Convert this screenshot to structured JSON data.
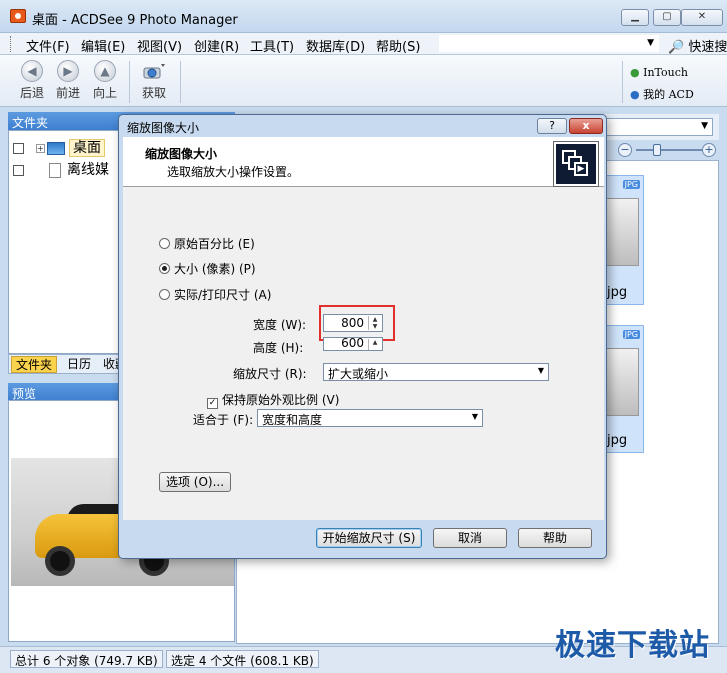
{
  "window": {
    "title": "桌面 - ACDSee 9 Photo Manager",
    "min_icon": "minimize-icon",
    "max_icon": "maximize-icon",
    "close_icon": "close-icon"
  },
  "menu": {
    "items": [
      "文件(F)",
      "编辑(E)",
      "视图(V)",
      "创建(R)",
      "工具(T)",
      "数据库(D)",
      "帮助(S)"
    ],
    "quick_search": "快速搜"
  },
  "toolbar": {
    "back": "后退",
    "forward": "前进",
    "up": "向上",
    "acquire": "获取",
    "intouch": "InTouch",
    "my_acd": "我的 ACD"
  },
  "folders_pane": {
    "header": "文件夹",
    "tree": [
      {
        "label": "桌面",
        "selected": true
      },
      {
        "label": "离线媒"
      }
    ],
    "tabs": [
      "文件夹",
      "日历",
      "收藏"
    ]
  },
  "preview_pane": {
    "header": "预览"
  },
  "thumbnails": [
    {
      "badge": "JPG",
      "label": "jpg"
    },
    {
      "badge": "JPG",
      "label": "jpg"
    }
  ],
  "status": {
    "total": "总计 6 个对象 (749.7 KB)",
    "selected": "选定 4 个文件 (608.1 KB)"
  },
  "watermark": "极速下载站",
  "dialog": {
    "title": "缩放图像大小",
    "help_btn": "?",
    "close_btn": "x",
    "heading": "缩放图像大小",
    "subheading": "选取缩放大小操作设置。",
    "radios": [
      {
        "label": "原始百分比 (E)",
        "checked": false
      },
      {
        "label": "大小 (像素) (P)",
        "checked": true
      },
      {
        "label": "实际/打印尺寸 (A)",
        "checked": false
      }
    ],
    "width_label": "宽度 (W):",
    "width_value": "800",
    "height_label": "高度 (H):",
    "height_value": "600",
    "resize_label": "缩放尺寸 (R):",
    "resize_value": "扩大或缩小",
    "keep_ratio_label": "保持原始外观比例 (V)",
    "keep_ratio_checked": true,
    "fit_label": "适合于 (F):",
    "fit_value": "宽度和高度",
    "options_btn": "选项 (O)...",
    "start_btn": "开始缩放尺寸 (S)",
    "cancel_btn": "取消",
    "help_button": "帮助"
  },
  "colors": {
    "accent": "#3d7fd0",
    "highlight": "#e0302b",
    "tab_active": "#fcd34d"
  }
}
